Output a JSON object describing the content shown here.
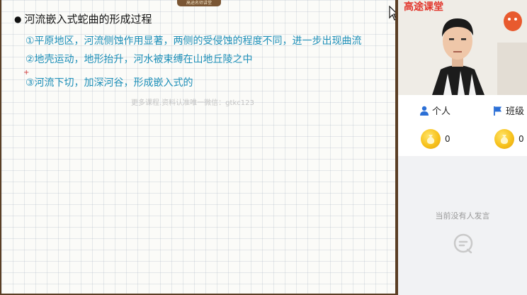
{
  "board": {
    "top_tab": "高途名师讲堂",
    "heading": "河流嵌入式蛇曲的形成过程",
    "lines": [
      "①平原地区，河流侧蚀作用显著，两侧的受侵蚀的程度不同，进一步出现曲流",
      "②地壳运动，地形抬升，河水被束缚在山地丘陵之中",
      "③河流下切，加深河谷，形成嵌入式的"
    ],
    "plus_mark": "+",
    "watermark": "更多课程.资料认准唯一微信：gtkc123"
  },
  "side": {
    "brand": "高途课堂",
    "tabs": {
      "person_label": "个人",
      "class_label": "班级"
    },
    "scores": {
      "person": "0",
      "class": "0"
    },
    "empty_text": "当前没有人发言"
  },
  "colors": {
    "accent_blue": "#1d8fb8",
    "brand_red": "#e2362c",
    "tab_icon_blue": "#2b6fd6",
    "coin_gold": "#f7c21c"
  },
  "icons": [
    "person-icon",
    "flag-icon",
    "coin-icon",
    "chat-empty-icon",
    "mouse-cursor-icon"
  ]
}
